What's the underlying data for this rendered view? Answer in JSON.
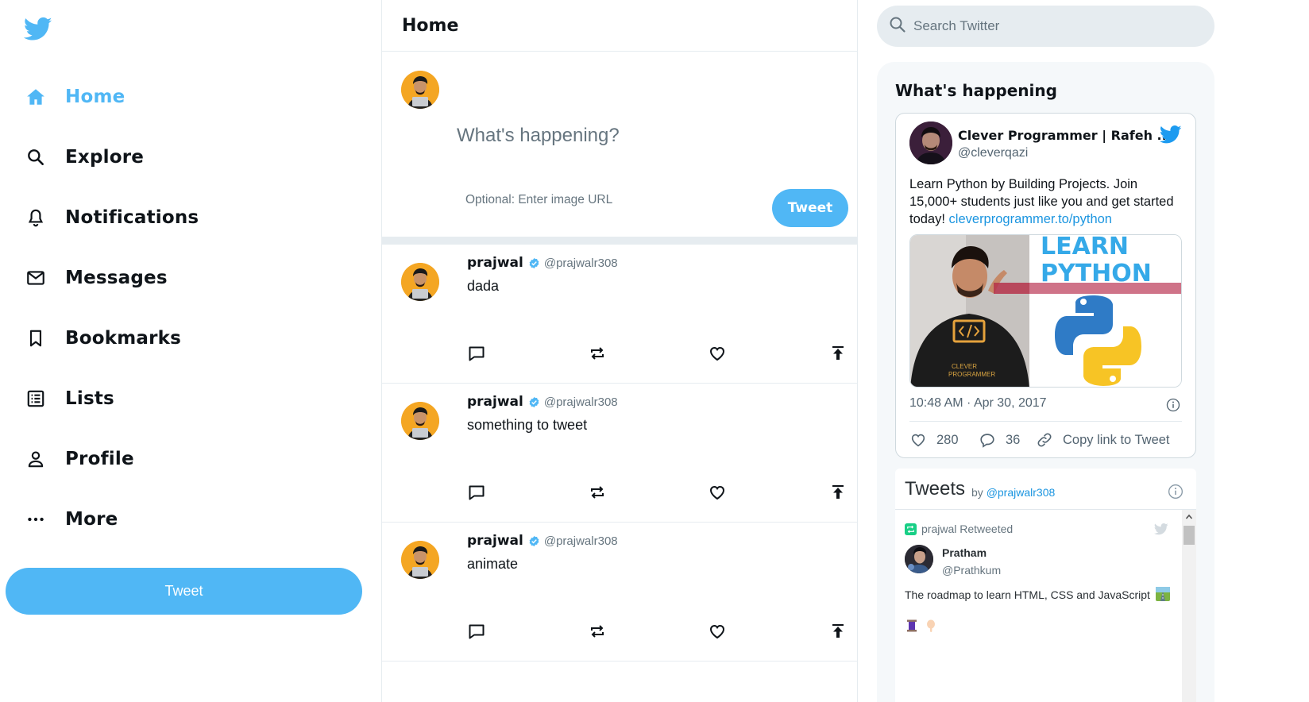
{
  "colors": {
    "accent": "#50b7f5",
    "text": "#0f1419",
    "muted": "#66757f",
    "border": "#e6ecf0",
    "link": "#1b95e0"
  },
  "sidebar": {
    "logo_icon": "twitter-bird-icon",
    "items": [
      {
        "label": "Home",
        "icon": "home-icon",
        "active": true
      },
      {
        "label": "Explore",
        "icon": "search-icon"
      },
      {
        "label": "Notifications",
        "icon": "bell-icon"
      },
      {
        "label": "Messages",
        "icon": "mail-icon"
      },
      {
        "label": "Bookmarks",
        "icon": "bookmark-icon"
      },
      {
        "label": "Lists",
        "icon": "list-icon"
      },
      {
        "label": "Profile",
        "icon": "person-icon"
      },
      {
        "label": "More",
        "icon": "more-icon"
      }
    ],
    "tweet_button": "Tweet"
  },
  "feed": {
    "title": "Home",
    "composer": {
      "placeholder": "What's happening?",
      "image_url_placeholder": "Optional: Enter image URL",
      "tweet_button": "Tweet"
    },
    "posts": [
      {
        "name": "prajwal",
        "handle": "@prajwalr308",
        "text": "dada"
      },
      {
        "name": "prajwal",
        "handle": "@prajwalr308",
        "text": "something to tweet"
      },
      {
        "name": "prajwal",
        "handle": "@prajwalr308",
        "text": "animate"
      }
    ]
  },
  "widgets": {
    "search_placeholder": "Search Twitter",
    "happening_title": "What's happening",
    "embed": {
      "name": "Clever Programmer | Rafeh ...",
      "handle": "@cleverqazi",
      "text": "Learn Python by Building Projects. Join 15,000+ students just like you and get started today!",
      "link": "cleverprogrammer.to/python",
      "media_title_line1": "LEARN",
      "media_title_line2": "PYTHON",
      "date": "10:48 AM · Apr 30, 2017",
      "likes": "280",
      "replies": "36",
      "copy_link": "Copy link to Tweet"
    },
    "timeline": {
      "title": "Tweets",
      "by_prefix": "by",
      "by_handle": "@prajwalr308",
      "retweeted_label": "prajwal Retweeted",
      "tweet_name": "Pratham",
      "tweet_handle": "@Prathkum",
      "tweet_text": "The roadmap to learn HTML, CSS and JavaScript"
    }
  }
}
